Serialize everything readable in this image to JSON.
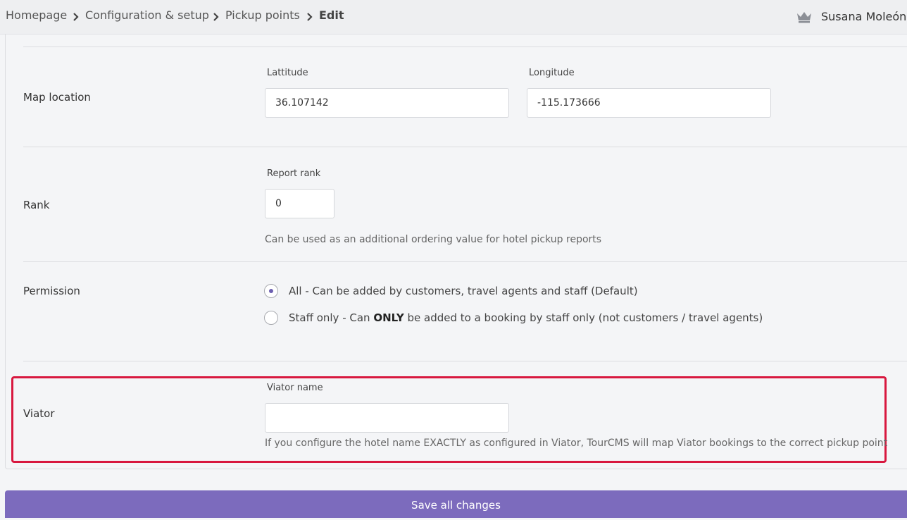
{
  "breadcrumb": {
    "items": [
      "Homepage",
      "Configuration & setup",
      "Pickup points"
    ],
    "current": "Edit"
  },
  "user": {
    "name": "Susana Moleón ("
  },
  "map_location": {
    "label": "Map location",
    "latitude_label": "Lattitude",
    "latitude_value": "36.107142",
    "longitude_label": "Longitude",
    "longitude_value": "-115.173666"
  },
  "rank": {
    "label": "Rank",
    "field_label": "Report rank",
    "value": "0",
    "help": "Can be used as an additional ordering value for hotel pickup reports"
  },
  "permission": {
    "label": "Permission",
    "option_all": "All - Can be added by customers, travel agents and staff (Default)",
    "option_staff_pre": "Staff only - Can ",
    "option_staff_bold": "ONLY",
    "option_staff_post": " be added to a booking by staff only (not customers / travel agents)",
    "selected": "all"
  },
  "viator": {
    "label": "Viator",
    "field_label": "Viator name",
    "value": "",
    "help": "If you configure the hotel name EXACTLY as configured in Viator, TourCMS will map Viator bookings to the correct pickup point"
  },
  "save_label": "Save all changes",
  "colors": {
    "accent": "#7c6bbd",
    "highlight": "#d8183f",
    "radio_dot": "#6c5fb0"
  }
}
